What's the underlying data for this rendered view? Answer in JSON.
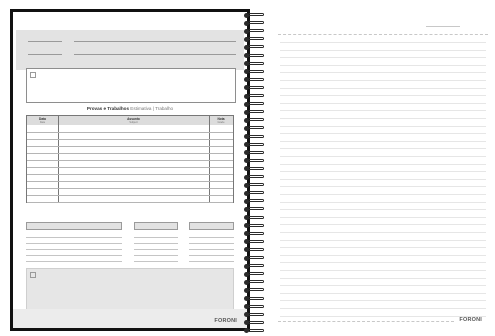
{
  "left_page": {
    "table_title": "Provas e Trabalhos",
    "table_subtitle": "Estimativa | Trabalho",
    "columns": [
      {
        "label": "Data",
        "sub": "Date"
      },
      {
        "label": "Assunto",
        "sub": "Subject"
      },
      {
        "label": "Nota",
        "sub": "Grade"
      }
    ],
    "brand": "FORONI"
  },
  "right_page": {
    "brand": "FORONI"
  },
  "colors": {
    "binding": "#2b2b2b",
    "band": "#e3e3e3",
    "rule": "#e6e6e6"
  }
}
